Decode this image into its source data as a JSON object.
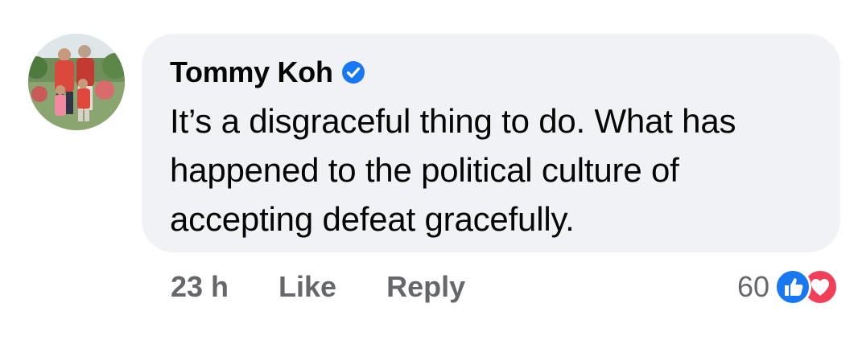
{
  "comment": {
    "author": "Tommy Koh",
    "verified": true,
    "text": "It’s a disgraceful thing to do. What has happened to the political culture of accepting defeat gracefully.",
    "timestamp": "23 h",
    "like_label": "Like",
    "reply_label": "Reply",
    "reaction_count": "60",
    "reactions": [
      "like-icon",
      "love-icon"
    ]
  },
  "colors": {
    "bubble_bg": "#f0f2f5",
    "meta_text": "#65676b",
    "verified_blue": "#1877f2",
    "like_blue": "#1877f2",
    "love_red": "#f33e58"
  }
}
